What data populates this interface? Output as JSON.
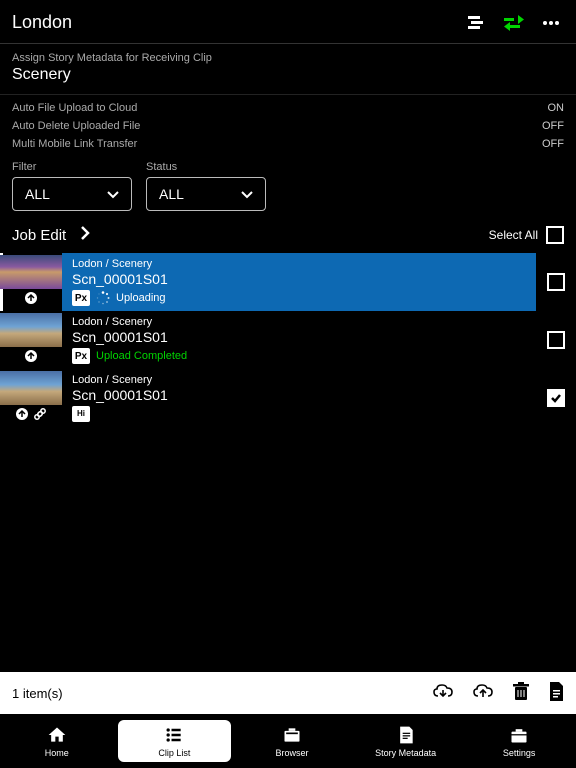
{
  "header": {
    "title": "London"
  },
  "metadata": {
    "sub": "Assign Story Metadata for Receiving Clip",
    "title": "Scenery"
  },
  "settings": [
    {
      "label": "Auto File Upload to Cloud",
      "value": "ON"
    },
    {
      "label": "Auto Delete Uploaded File",
      "value": "OFF"
    },
    {
      "label": "Multi Mobile Link Transfer",
      "value": "OFF"
    }
  ],
  "filters": {
    "filter": {
      "label": "Filter",
      "value": "ALL"
    },
    "status": {
      "label": "Status",
      "value": "ALL"
    }
  },
  "jobedit": {
    "label": "Job Edit",
    "select_all": "Select All"
  },
  "clips": [
    {
      "sub": "Lodon / Scenery",
      "title": "Scn_00001S01",
      "badge": "Px",
      "status": "Uploading",
      "status_kind": "uploading",
      "checked": false,
      "selected": true,
      "thumb": "field"
    },
    {
      "sub": "Lodon / Scenery",
      "title": "Scn_00001S01",
      "badge": "Px",
      "status": "Upload Completed",
      "status_kind": "completed",
      "checked": false,
      "selected": false,
      "thumb": "sunset"
    },
    {
      "sub": "Lodon / Scenery",
      "title": "Scn_00001S01",
      "badge": "Hi",
      "status": "",
      "status_kind": "none",
      "checked": true,
      "selected": false,
      "thumb": "sunset"
    }
  ],
  "toolbar": {
    "count": "1 item(s)"
  },
  "nav": {
    "home": "Home",
    "cliplist": "Clip List",
    "browser": "Browser",
    "story": "Story Metadata",
    "settings": "Settings"
  }
}
